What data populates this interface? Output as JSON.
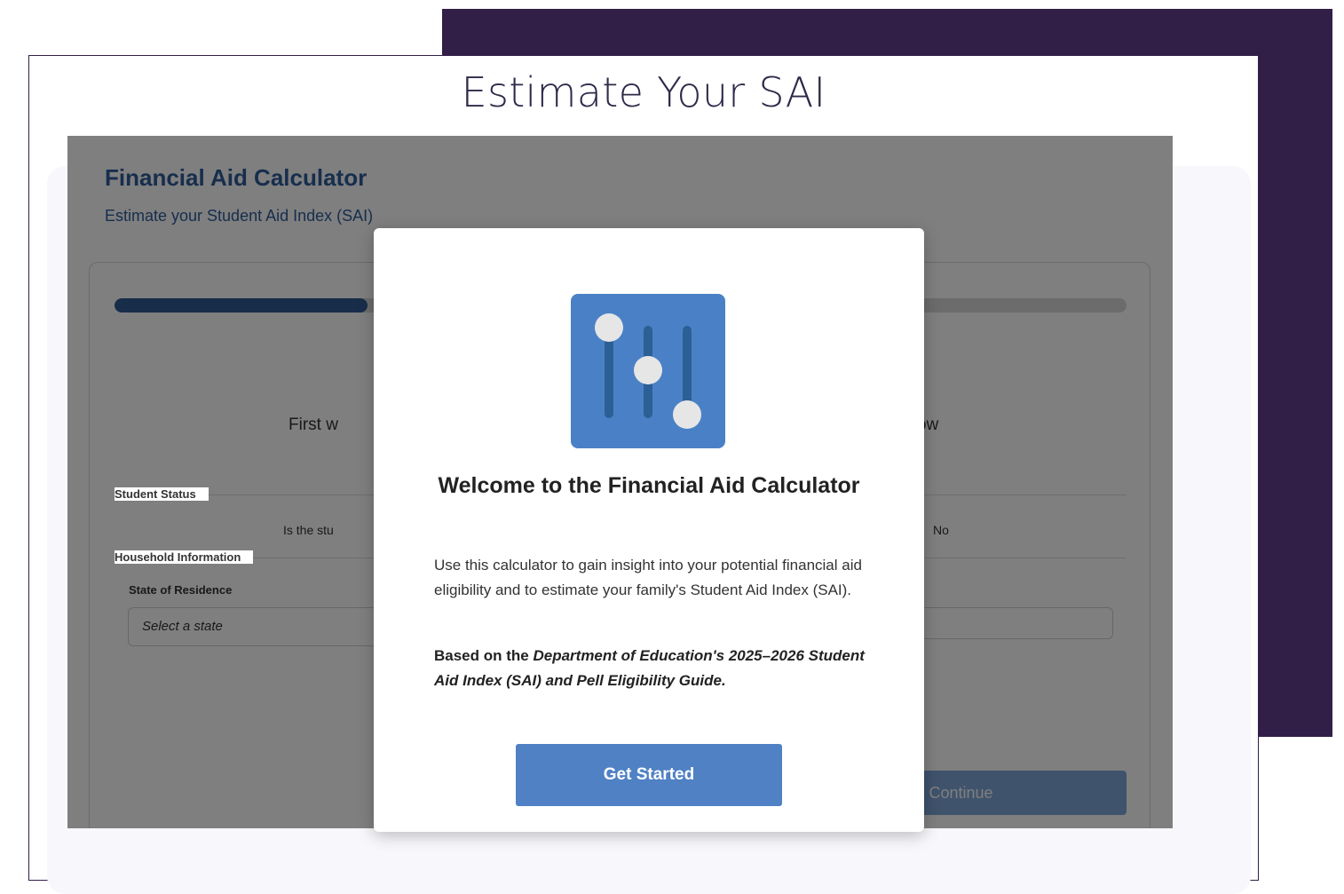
{
  "page": {
    "title": "Estimate Your SAI"
  },
  "calculator": {
    "heading": "Financial Aid Calculator",
    "subheading": "Estimate your Student Aid Index (SAI)",
    "progress_fraction": 0.25,
    "intro_left": "First w",
    "intro_right": "ne how",
    "sections": {
      "student_status": "Student Status",
      "household_info": "Household Information"
    },
    "question": "Is the stu",
    "toggle_label": "No",
    "state_field": {
      "label": "State of Residence",
      "placeholder": "Select a state"
    },
    "continue_label": "Continue"
  },
  "modal": {
    "icon": "sliders-icon",
    "title": "Welcome to the Financial Aid Calculator",
    "description": "Use this calculator to gain insight into your potential financial aid eligibility and to estimate your family's Student Aid Index (SAI).",
    "basis_prefix": "Based on the ",
    "basis_source": "Department of Education's 2025–2026 Student Aid Index (SAI) and Pell Eligibility Guide.",
    "button_label": "Get Started"
  },
  "colors": {
    "purple": "#311f48",
    "brand_blue": "#2e5d9a",
    "button_blue": "#4f81c4",
    "icon_blue": "#4a81c6"
  }
}
